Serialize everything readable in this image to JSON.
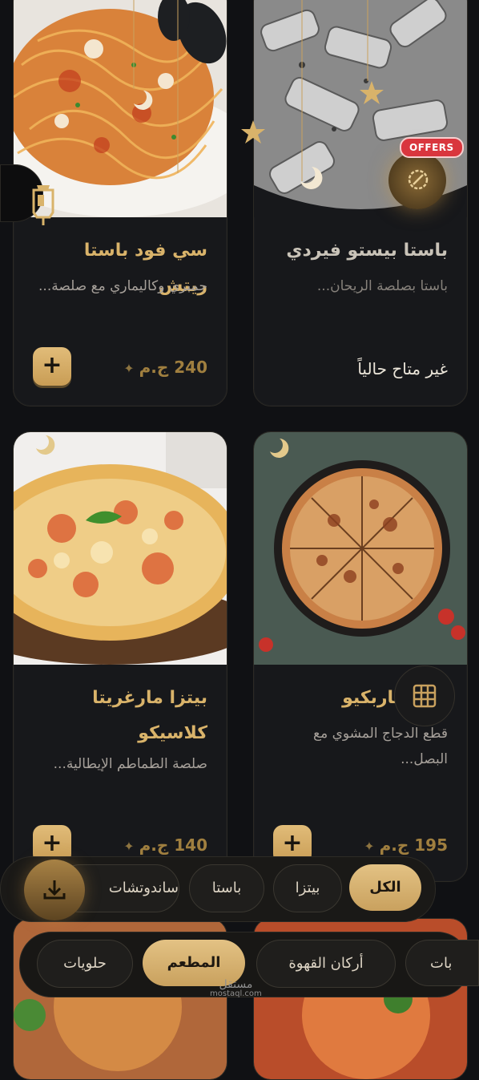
{
  "cards": [
    {
      "title": "سي فود باستا ريتش",
      "desc": "جمبري وكاليماري مع صلصة...",
      "price": "240 ج.م",
      "add_label": "+"
    },
    {
      "title": "باستا بيستو فيردي",
      "desc": "باستا بصلصة الريحان...",
      "badge": "OFFERS",
      "status": "غير متاح حالياً"
    },
    {
      "title": "بيتزا مارغريتا كلاسيكو",
      "desc": "صلصة الطماطم الإيطالية...",
      "price": "140 ج.م",
      "add_label": "+"
    },
    {
      "title": "دجاج باربكيو",
      "desc": "قطع الدجاج المشوي مع البصل...",
      "price": "195 ج.م",
      "add_label": "+"
    }
  ],
  "category_tabs": [
    {
      "label": "الكل",
      "active": true
    },
    {
      "label": "بيتزا",
      "active": false
    },
    {
      "label": "باستا",
      "active": false
    },
    {
      "label": "ساندوتشات",
      "active": false
    }
  ],
  "section_tabs": [
    {
      "label": "بات",
      "active": false
    },
    {
      "label": "أركان القهوة",
      "active": false
    },
    {
      "label": "المطعم",
      "active": true
    },
    {
      "label": "حلويات",
      "active": false
    }
  ],
  "watermark": {
    "line1": "مستقل",
    "line2": "mostaql.com"
  },
  "colors": {
    "accent": "#d9b36a",
    "background": "#101114",
    "offer_badge": "#d9363e"
  },
  "icons": {
    "lantern": "lantern-icon",
    "add": "plus-icon",
    "grid": "grid-icon",
    "download": "download-icon",
    "sparkle": "sparkle-icon",
    "crescent": "crescent-moon-icon",
    "star": "star-icon"
  }
}
